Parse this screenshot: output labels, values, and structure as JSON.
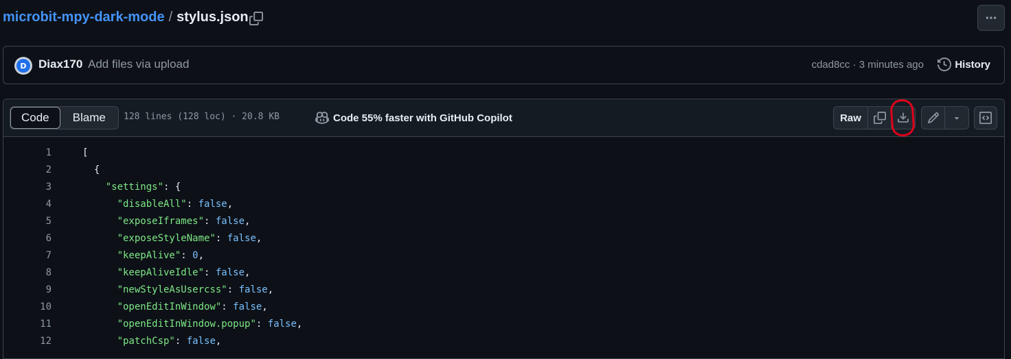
{
  "breadcrumb": {
    "repo": "microbit-mpy-dark-mode",
    "separator": "/",
    "file": "stylus.json"
  },
  "icons": {
    "copy_path": "copy-icon",
    "more": "kebab-horizontal-icon"
  },
  "commit": {
    "author": "Diax170",
    "message": "Add files via upload",
    "meta": "cdad8cc · 3 minutes ago",
    "history_label": "History"
  },
  "file_header": {
    "tabs": [
      "Code",
      "Blame"
    ],
    "active_tab": "Code",
    "stats": "128 lines (128 loc) · 20.8 KB",
    "copilot_promo": "Code 55% faster with GitHub Copilot",
    "raw_label": "Raw"
  },
  "annotation": {
    "highlighted": "download-raw-file",
    "color": "#e0001b"
  },
  "colors": {
    "background": "#0d1117",
    "link": "#4493f8",
    "json_key": "#7ee787",
    "json_value": "#79c0ff"
  },
  "code_lines": [
    {
      "num": "1",
      "indent": "",
      "key": "",
      "punct_after_key": "",
      "value": "",
      "tail": "["
    },
    {
      "num": "2",
      "indent": "  ",
      "key": "",
      "punct_after_key": "",
      "value": "",
      "tail": "{"
    },
    {
      "num": "3",
      "indent": "    ",
      "key": "\"settings\"",
      "punct_after_key": ": ",
      "value": "",
      "tail": "{"
    },
    {
      "num": "4",
      "indent": "      ",
      "key": "\"disableAll\"",
      "punct_after_key": ": ",
      "value": "false",
      "tail": ","
    },
    {
      "num": "5",
      "indent": "      ",
      "key": "\"exposeIframes\"",
      "punct_after_key": ": ",
      "value": "false",
      "tail": ","
    },
    {
      "num": "6",
      "indent": "      ",
      "key": "\"exposeStyleName\"",
      "punct_after_key": ": ",
      "value": "false",
      "tail": ","
    },
    {
      "num": "7",
      "indent": "      ",
      "key": "\"keepAlive\"",
      "punct_after_key": ": ",
      "value": "0",
      "tail": ","
    },
    {
      "num": "8",
      "indent": "      ",
      "key": "\"keepAliveIdle\"",
      "punct_after_key": ": ",
      "value": "false",
      "tail": ","
    },
    {
      "num": "9",
      "indent": "      ",
      "key": "\"newStyleAsUsercss\"",
      "punct_after_key": ": ",
      "value": "false",
      "tail": ","
    },
    {
      "num": "10",
      "indent": "      ",
      "key": "\"openEditInWindow\"",
      "punct_after_key": ": ",
      "value": "false",
      "tail": ","
    },
    {
      "num": "11",
      "indent": "      ",
      "key": "\"openEditInWindow.popup\"",
      "punct_after_key": ": ",
      "value": "false",
      "tail": ","
    },
    {
      "num": "12",
      "indent": "      ",
      "key": "\"patchCsp\"",
      "punct_after_key": ": ",
      "value": "false",
      "tail": ","
    }
  ]
}
